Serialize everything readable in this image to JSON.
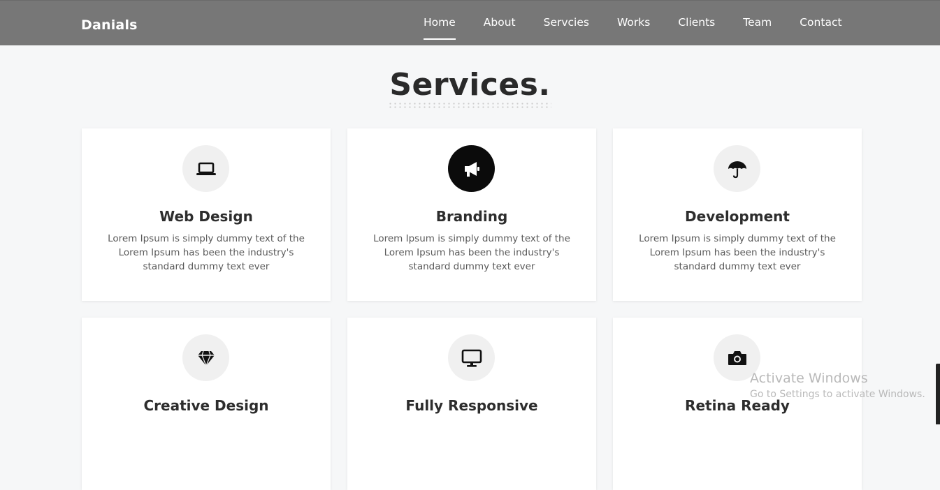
{
  "nav": {
    "brand": "Danials",
    "links": [
      "Home",
      "About",
      "Servcies",
      "Works",
      "Clients",
      "Team",
      "Contact"
    ],
    "active_index": 0
  },
  "section": {
    "title": "Services."
  },
  "cards": [
    {
      "icon": "laptop-icon",
      "title": "Web Design",
      "text": "Lorem Ipsum is simply dummy text of the Lorem Ipsum has been the industry's standard dummy text ever"
    },
    {
      "icon": "megaphone-icon",
      "title": "Branding",
      "text": "Lorem Ipsum is simply dummy text of the Lorem Ipsum has been the industry's standard dummy text ever"
    },
    {
      "icon": "umbrella-icon",
      "title": "Development",
      "text": "Lorem Ipsum is simply dummy text of the Lorem Ipsum has been the industry's standard dummy text ever"
    },
    {
      "icon": "diamond-icon",
      "title": "Creative Design",
      "text": ""
    },
    {
      "icon": "desktop-icon",
      "title": "Fully Responsive",
      "text": ""
    },
    {
      "icon": "camera-icon",
      "title": "Retina Ready",
      "text": ""
    }
  ],
  "watermark": {
    "title": "Activate Windows",
    "subtitle": "Go to Settings to activate Windows."
  },
  "colors": {
    "navbar": "#777777",
    "page_bg": "#f6f7f8",
    "active_icon_bg": "#0b0b0b"
  }
}
